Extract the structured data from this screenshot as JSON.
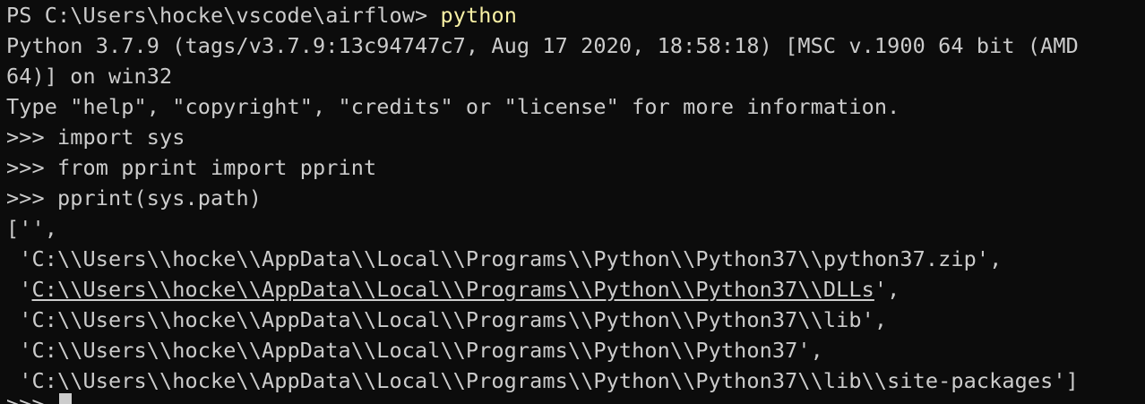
{
  "terminal": {
    "prompt_path": "PS C:\\Users\\hocke\\vscode\\airflow> ",
    "prompt_command": "python",
    "banner_line1": "Python 3.7.9 (tags/v3.7.9:13c94747c7, Aug 17 2020, 18:58:18) [MSC v.1900 64 bit (AMD",
    "banner_line2": "64)] on win32",
    "banner_line3": "Type \"help\", \"copyright\", \"credits\" or \"license\" for more information.",
    "repl_lines": [
      ">>> import sys",
      ">>> from pprint import pprint",
      ">>> pprint(sys.path)"
    ],
    "output_open": "['',",
    "path_1": " 'C:\\\\Users\\\\hocke\\\\AppData\\\\Local\\\\Programs\\\\Python\\\\Python37\\\\python37.zip',",
    "path_2_prefix": " '",
    "path_2_link": "C:\\\\Users\\\\hocke\\\\AppData\\\\Local\\\\Programs\\\\Python\\\\Python37\\\\DLLs",
    "path_2_suffix": "',",
    "path_3": " 'C:\\\\Users\\\\hocke\\\\AppData\\\\Local\\\\Programs\\\\Python\\\\Python37\\\\lib',",
    "path_4": " 'C:\\\\Users\\\\hocke\\\\AppData\\\\Local\\\\Programs\\\\Python\\\\Python37',",
    "path_5": " 'C:\\\\Users\\\\hocke\\\\AppData\\\\Local\\\\Programs\\\\Python\\\\Python37\\\\lib\\\\site-packages']",
    "final_prompt": ">>> "
  },
  "colors": {
    "background": "#0c0c0c",
    "text": "#cccccc",
    "command_highlight": "#f9f1a5"
  }
}
